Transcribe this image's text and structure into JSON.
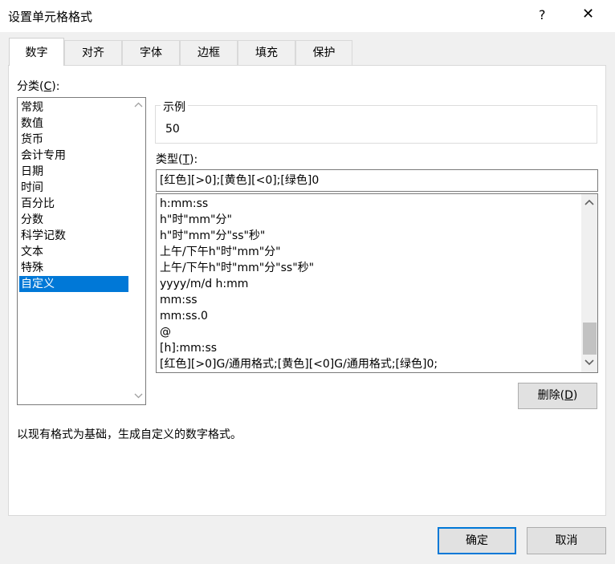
{
  "window": {
    "title": "设置单元格格式",
    "help": "?",
    "close": "✕"
  },
  "tabs": [
    {
      "label": "数字"
    },
    {
      "label": "对齐"
    },
    {
      "label": "字体"
    },
    {
      "label": "边框"
    },
    {
      "label": "填充"
    },
    {
      "label": "保护"
    }
  ],
  "category": {
    "label_prefix": "分类(",
    "label_key": "C",
    "label_suffix": "):",
    "items": [
      "常规",
      "数值",
      "货币",
      "会计专用",
      "日期",
      "时间",
      "百分比",
      "分数",
      "科学记数",
      "文本",
      "特殊",
      "自定义"
    ],
    "selected": "自定义"
  },
  "sample": {
    "label": "示例",
    "value": "50"
  },
  "type": {
    "label_prefix": "类型(",
    "label_key": "T",
    "label_suffix": "):",
    "value": "[红色][>0];[黄色][<0];[绿色]0"
  },
  "format_list": [
    "h:mm:ss",
    "h\"时\"mm\"分\"",
    "h\"时\"mm\"分\"ss\"秒\"",
    "上午/下午h\"时\"mm\"分\"",
    "上午/下午h\"时\"mm\"分\"ss\"秒\"",
    "yyyy/m/d h:mm",
    "mm:ss",
    "mm:ss.0",
    "@",
    "[h]:mm:ss",
    "[红色][>0]G/通用格式;[黄色][<0]G/通用格式;[绿色]0;"
  ],
  "delete_button": {
    "prefix": "删除(",
    "key": "D",
    "suffix": ")"
  },
  "description": "以现有格式为基础，生成自定义的数字格式。",
  "footer": {
    "ok": "确定",
    "cancel": "取消"
  },
  "icons": {
    "scroll_up": "up-arrow-icon",
    "scroll_down": "down-arrow-icon"
  }
}
